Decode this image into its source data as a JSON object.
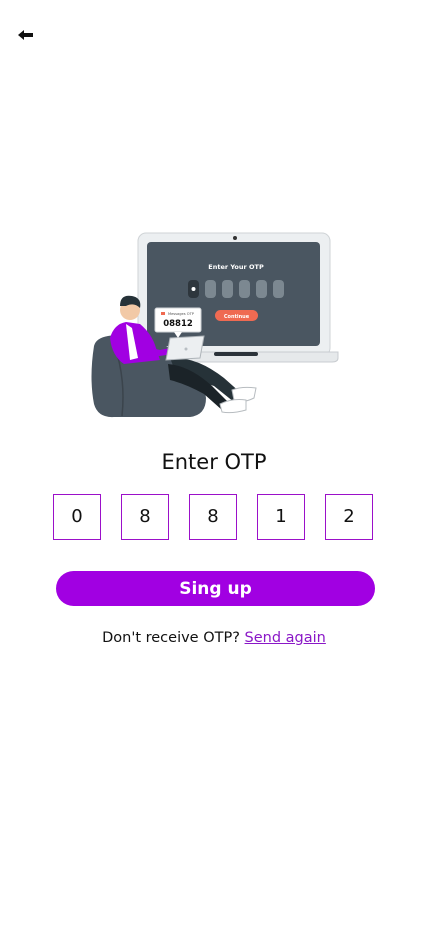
{
  "header": {
    "back_icon": "arrow-left-icon"
  },
  "illustration": {
    "screen_title": "Enter Your OTP",
    "screen_button": "Continue",
    "phone_caption": "Messages OTP",
    "phone_code": "08812",
    "colors": {
      "laptop": "#eceff1",
      "screen": "#4a5661",
      "button": "#ef6a52",
      "shirt": "#a100e2",
      "chair": "#4a5661"
    }
  },
  "title": "Enter OTP",
  "otp": {
    "digits": [
      "0",
      "8",
      "8",
      "1",
      "2"
    ]
  },
  "cta": {
    "label": "Sing up"
  },
  "resend": {
    "prompt": "Don't receive OTP?",
    "link": "Send again"
  },
  "colors": {
    "accent": "#a100e2",
    "box_border": "#9b10c9",
    "link": "#8a17c7"
  }
}
